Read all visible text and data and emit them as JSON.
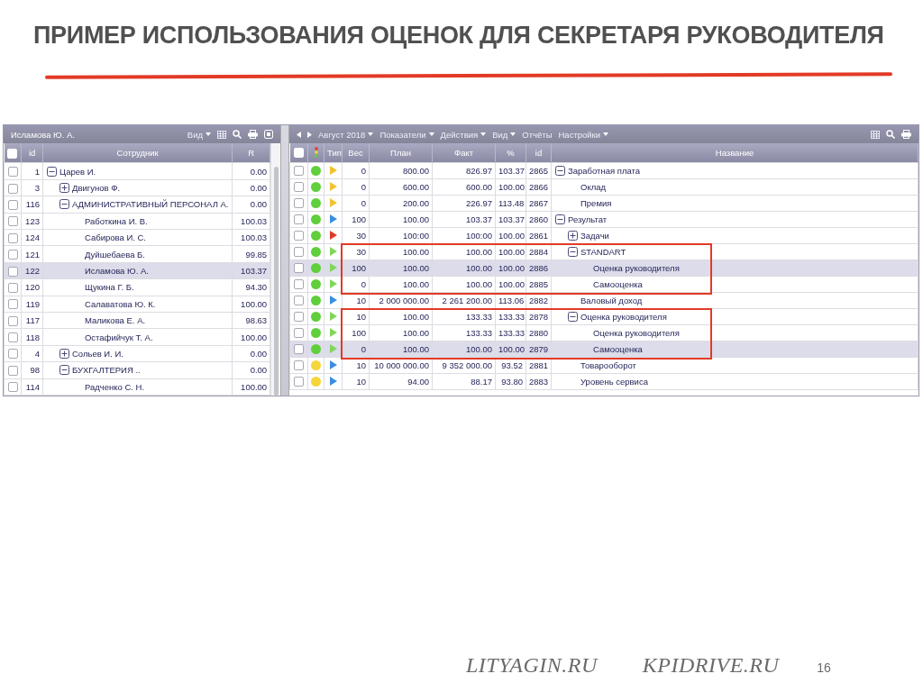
{
  "slide": {
    "title": "ПРИМЕР ИСПОЛЬЗОВАНИЯ ОЦЕНОК ДЛЯ СЕКРЕТАРЯ РУКОВОДИТЕЛЯ",
    "footer_links": [
      "LITYAGIN.RU",
      "KPIDRIVE.RU"
    ],
    "page_number": "16"
  },
  "employees_panel": {
    "title": "Исламова Ю. А.",
    "menus": [
      "Вид"
    ],
    "columns": [
      "id",
      "Сотрудник",
      "R"
    ],
    "all_checked": false,
    "rows": [
      {
        "id": "1",
        "name": "Царев И.",
        "r": "0.00",
        "expanded": true,
        "checked": false,
        "selected": false,
        "children": [
          {
            "id": "3",
            "name": "Двигунов Ф.",
            "r": "0.00",
            "expanded": false,
            "checked": false,
            "selected": false
          },
          {
            "id": "116",
            "name": "АДМИНИСТРАТИВНЫЙ ПЕРСОНАЛ А.",
            "r": "0.00",
            "expanded": true,
            "checked": false,
            "selected": false,
            "children": [
              {
                "id": "123",
                "name": "Работкина И. В.",
                "r": "100.03",
                "checked": false,
                "selected": false
              },
              {
                "id": "124",
                "name": "Сабирова И. С.",
                "r": "100.03",
                "checked": false,
                "selected": false
              },
              {
                "id": "121",
                "name": "Дуйшебаева Б.",
                "r": "99.85",
                "checked": false,
                "selected": false
              },
              {
                "id": "122",
                "name": "Исламова Ю. А.",
                "r": "103.37",
                "checked": false,
                "selected": true
              },
              {
                "id": "120",
                "name": "Щукина Г. Б.",
                "r": "94.30",
                "checked": false,
                "selected": false
              },
              {
                "id": "119",
                "name": "Салаватова Ю. К.",
                "r": "100.00",
                "checked": false,
                "selected": false
              },
              {
                "id": "117",
                "name": "Маликова Е. А.",
                "r": "98.63",
                "checked": false,
                "selected": false
              },
              {
                "id": "118",
                "name": "Остафийчук Т. А.",
                "r": "100.00",
                "checked": false,
                "selected": false
              }
            ]
          },
          {
            "id": "4",
            "name": "Сольев И. И.",
            "r": "0.00",
            "expanded": false,
            "checked": false,
            "selected": false
          },
          {
            "id": "98",
            "name": "БУХГАЛТЕРИЯ ..",
            "r": "0.00",
            "expanded": true,
            "checked": false,
            "selected": false,
            "children": [
              {
                "id": "114",
                "name": "Радченко С. Н.",
                "r": "100.00",
                "checked": false,
                "selected": false
              }
            ]
          }
        ]
      }
    ]
  },
  "indicators_panel": {
    "period": "Август 2018",
    "menus": [
      {
        "label": "Показатели",
        "dropdown": true
      },
      {
        "label": "Действия",
        "dropdown": true
      },
      {
        "label": "Вид",
        "dropdown": true
      },
      {
        "label": "Отчёты",
        "dropdown": false
      },
      {
        "label": "Настройки",
        "dropdown": true
      }
    ],
    "columns": [
      "Тип",
      "Вес",
      "План",
      "Факт",
      "%",
      "id",
      "Название"
    ],
    "all_checked": false,
    "rows": [
      {
        "weight": "0",
        "plan": "800.00",
        "fact": "826.97",
        "percent": "103.37",
        "id": "2865",
        "name": "Заработная плата",
        "color": "#5fcf3c",
        "type_icon": {
          "color": "#f2c230"
        },
        "expanded": true,
        "checked": false,
        "selected": false,
        "framed": false,
        "children": [
          {
            "weight": "0",
            "plan": "600.00",
            "fact": "600.00",
            "percent": "100.00",
            "id": "2866",
            "name": "Оклад",
            "color": "#5fcf3c",
            "type_icon": {
              "color": "#f2c230"
            },
            "checked": false,
            "selected": false,
            "framed": false
          },
          {
            "weight": "0",
            "plan": "200.00",
            "fact": "226.97",
            "percent": "113.48",
            "id": "2867",
            "name": "Премия",
            "color": "#5fcf3c",
            "type_icon": {
              "color": "#f2c230"
            },
            "checked": false,
            "selected": false,
            "framed": false
          }
        ]
      },
      {
        "weight": "100",
        "plan": "100.00",
        "fact": "103.37",
        "percent": "103.37",
        "id": "2860",
        "name": "Результат",
        "color": "#5fcf3c",
        "type_icon": {
          "color": "#3a8ee0"
        },
        "expanded": true,
        "checked": false,
        "selected": false,
        "framed": false,
        "children": [
          {
            "weight": "30",
            "plan": "100:00",
            "fact": "100:00",
            "percent": "100.00",
            "id": "2861",
            "name": "Задачи",
            "color": "#5fcf3c",
            "type_icon": {
              "color": "#e0392a"
            },
            "expanded": false,
            "checked": false,
            "selected": false,
            "framed": false
          },
          {
            "weight": "30",
            "plan": "100.00",
            "fact": "100.00",
            "percent": "100.00",
            "id": "2884",
            "name": "STANDART",
            "color": "#5fcf3c",
            "type_icon": {
              "color": "#7fd65a"
            },
            "expanded": true,
            "checked": false,
            "selected": false,
            "framed": true,
            "children": [
              {
                "weight": "100",
                "plan": "100.00",
                "fact": "100.00",
                "percent": "100.00",
                "id": "2886",
                "name": "Оценка руководителя",
                "color": "#5fcf3c",
                "type_icon": {
                  "color": "#7fd65a"
                },
                "checked": false,
                "selected": true,
                "framed": true
              },
              {
                "weight": "0",
                "plan": "100.00",
                "fact": "100.00",
                "percent": "100.00",
                "id": "2885",
                "name": "Самооценка",
                "color": "#5fcf3c",
                "type_icon": {
                  "color": "#7fd65a"
                },
                "checked": false,
                "selected": false,
                "framed": true
              }
            ]
          },
          {
            "weight": "10",
            "plan": "2 000 000.00",
            "fact": "2 261 200.00",
            "percent": "113.06",
            "id": "2882",
            "name": "Валовый доход",
            "color": "#5fcf3c",
            "type_icon": {
              "color": "#3a8ee0"
            },
            "checked": false,
            "selected": false,
            "framed": false
          },
          {
            "weight": "10",
            "plan": "100.00",
            "fact": "133.33",
            "percent": "133.33",
            "id": "2878",
            "name": "Оценка руководителя",
            "color": "#5fcf3c",
            "type_icon": {
              "color": "#7fd65a"
            },
            "expanded": true,
            "checked": false,
            "selected": false,
            "framed": true,
            "children": [
              {
                "weight": "100",
                "plan": "100.00",
                "fact": "133.33",
                "percent": "133.33",
                "id": "2880",
                "name": "Оценка руководителя",
                "color": "#5fcf3c",
                "type_icon": {
                  "color": "#7fd65a"
                },
                "checked": false,
                "selected": false,
                "framed": true
              },
              {
                "weight": "0",
                "plan": "100.00",
                "fact": "100.00",
                "percent": "100.00",
                "id": "2879",
                "name": "Самооценка",
                "color": "#5fcf3c",
                "type_icon": {
                  "color": "#7fd65a"
                },
                "checked": false,
                "selected": true,
                "framed": true
              }
            ]
          },
          {
            "weight": "10",
            "plan": "10 000 000.00",
            "fact": "9 352 000.00",
            "percent": "93.52",
            "id": "2881",
            "name": "Товарооборот",
            "color": "#f5d63a",
            "type_icon": {
              "color": "#3a8ee0"
            },
            "checked": false,
            "selected": false,
            "framed": false
          },
          {
            "weight": "10",
            "plan": "94.00",
            "fact": "88.17",
            "percent": "93.80",
            "id": "2883",
            "name": "Уровень сервиса",
            "color": "#f5d63a",
            "type_icon": {
              "color": "#3a8ee0"
            },
            "checked": false,
            "selected": false,
            "framed": false
          }
        ]
      }
    ]
  }
}
